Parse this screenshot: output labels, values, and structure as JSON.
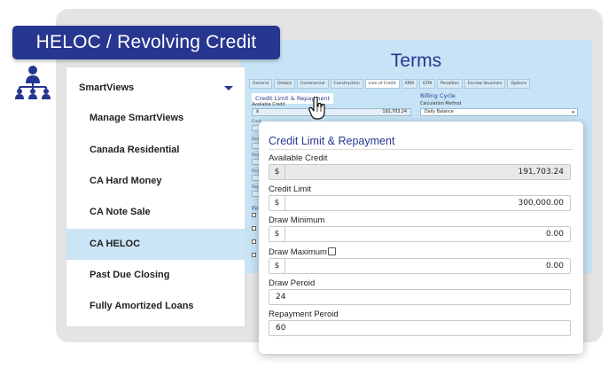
{
  "banner": {
    "title": "HELOC / Revolving Credit"
  },
  "icons": {
    "org": "org-chart-icon",
    "cursor": "hand-pointer-icon",
    "caret": "chevron-down-icon"
  },
  "colors": {
    "brand": "#27368f",
    "terms_bg": "#c7e3f6",
    "active_item": "#cbe5f6"
  },
  "terms": {
    "title": "Terms",
    "tabs": [
      "General",
      "Details",
      "Commercial",
      "Construction",
      "Line of Credit",
      "ARM",
      "GTM",
      "Penalties",
      "Escrow Vouchers",
      "Options"
    ],
    "active_tab": "Line of Credit",
    "section": "Credit Limit & Repayment",
    "available_credit_label": "Available Credit",
    "available_credit_prefix": "$",
    "available_credit_value": "191,703.24",
    "billing_title": "Billing Cycle",
    "calc_label": "Calculation Method",
    "calc_value": "Daily Balance",
    "frag_labels": [
      "Cred",
      "Draw",
      "Draw",
      "Draw",
      "Repa"
    ],
    "fi_label": "Fir"
  },
  "sidebar": {
    "header": "SmartViews",
    "items": [
      {
        "label": "Manage SmartViews"
      },
      {
        "label": "Canada Residential"
      },
      {
        "label": "CA Hard Money"
      },
      {
        "label": "CA Note Sale"
      },
      {
        "label": "CA HELOC"
      },
      {
        "label": "Past Due Closing"
      },
      {
        "label": "Fully Amortized Loans"
      }
    ],
    "active_index": 4
  },
  "card": {
    "title": "Credit Limit & Repayment",
    "available_credit": {
      "label": "Available Credit",
      "prefix": "$",
      "value": "191,703.24"
    },
    "credit_limit": {
      "label": "Credit Limit",
      "prefix": "$",
      "value": "300,000.00"
    },
    "draw_minimum": {
      "label": "Draw Minimum",
      "prefix": "$",
      "value": "0.00"
    },
    "draw_maximum": {
      "label": "Draw Maximum",
      "prefix": "$",
      "value": "0.00",
      "checked": false
    },
    "draw_period": {
      "label": "Draw Peroid",
      "value": "24"
    },
    "repayment_period": {
      "label": "Repayment Peroid",
      "value": "60"
    }
  }
}
